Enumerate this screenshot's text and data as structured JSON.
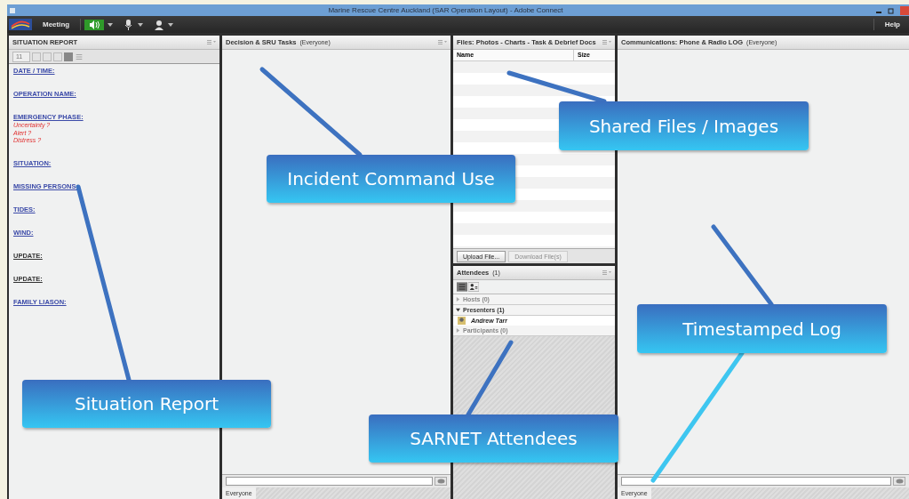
{
  "window": {
    "title": "Marine Rescue Centre Auckland (SAR Operation Layout) - Adobe Connect"
  },
  "toolbar": {
    "menu": "Meeting",
    "speaker": {
      "on": true
    },
    "help": "Help"
  },
  "situation_report": {
    "title": "SITUATION REPORT",
    "font_size": "11",
    "entries": [
      {
        "label": "DATE / TIME:",
        "color": "#3b4aa8"
      },
      {
        "label": "OPERATION NAME:",
        "color": "#3b4aa8"
      },
      {
        "label": "EMERGENCY PHASE:",
        "color": "#3b4aa8",
        "options": [
          "Uncertainty ?",
          "Alert ?",
          "Distress ?"
        ]
      },
      {
        "label": "SITUATION:",
        "color": "#3b4aa8"
      },
      {
        "label": "MISSING PERSONS:",
        "color": "#3b4aa8"
      },
      {
        "label": "TIDES:",
        "color": "#3b4aa8"
      },
      {
        "label": "WIND:",
        "color": "#3b4aa8"
      },
      {
        "label": "UPDATE:",
        "color": "#333333"
      },
      {
        "label": "UPDATE:",
        "color": "#333333"
      },
      {
        "label": "FAMILY LIASON:",
        "color": "#3b4aa8"
      }
    ]
  },
  "decision_pod": {
    "title": "Decision & SRU Tasks",
    "audience": "(Everyone)",
    "tab": "Everyone"
  },
  "files_pod": {
    "title": "Files: Photos - Charts - Task & Debrief Docs",
    "columns": [
      "Name",
      "Size"
    ],
    "buttons": [
      {
        "label": "Upload File...",
        "disabled": false
      },
      {
        "label": "Download File(s)",
        "disabled": true
      }
    ]
  },
  "attendees_pod": {
    "title": "Attendees",
    "count": "(1)",
    "groups": [
      {
        "label": "Hosts (0)",
        "expanded": false
      },
      {
        "label": "Presenters (1)",
        "expanded": true,
        "members": [
          "Andrew Tarr"
        ]
      },
      {
        "label": "Participants (0)",
        "expanded": false
      }
    ]
  },
  "communications_pod": {
    "title": "Communications: Phone & Radio LOG",
    "audience": "(Everyone)",
    "tab": "Everyone"
  },
  "callouts": [
    {
      "text": "Situation Report"
    },
    {
      "text": "Incident Command Use"
    },
    {
      "text": "Shared Files / Images"
    },
    {
      "text": "Timestamped Log"
    },
    {
      "text": "SARNET Attendees"
    }
  ]
}
